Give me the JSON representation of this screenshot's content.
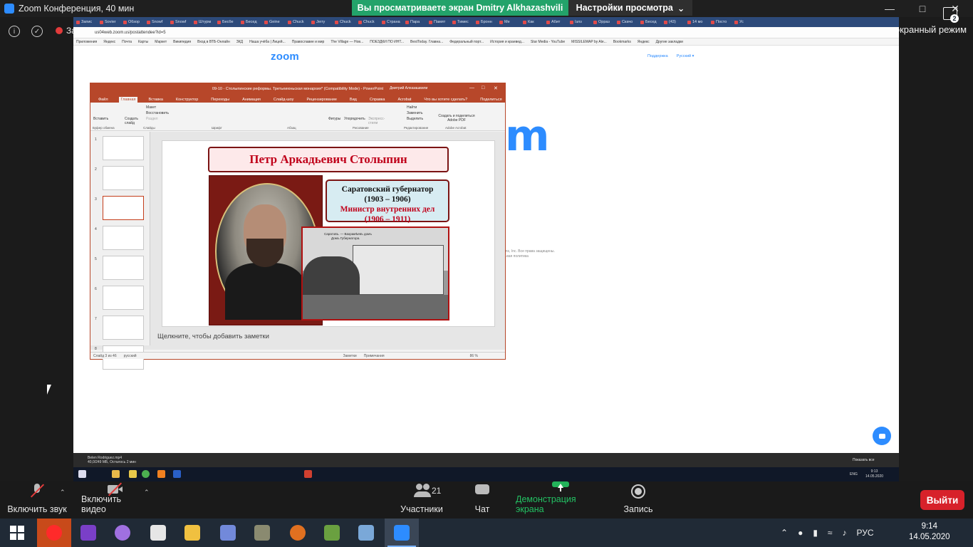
{
  "zoom": {
    "window_title": "Zoom Конференция, 40 мин",
    "share_banner": "Вы просматриваете экран Dmitry Alkhazashvili",
    "view_options": "Настройки просмотра",
    "recording_label": "Запись",
    "fullscreen_label": "Войти в полноэкранный режим"
  },
  "browser": {
    "tabs": [
      "Запис",
      "Sovier",
      "Обзор",
      "Snowf",
      "Snowf",
      "Штурм",
      "Бесбе",
      "Бесед",
      "Geine",
      "Chuck",
      "Jerry",
      "Chuck",
      "Chuck",
      "Страна",
      "Пара",
      "Памят",
      "Тимес",
      "Бронн",
      "Ме",
      "Как",
      "Абит",
      "Ізлз",
      "Орраз",
      "Скачо",
      "Бесед",
      "(43)",
      "14 мо",
      "Посто",
      "Ус"
    ],
    "url": "us04web.zoom.us/postattendee?id=5",
    "bookmarks": [
      "Приложения",
      "Яндекс",
      "Почта",
      "Карты",
      "Маркет",
      "Википедия",
      "Вход в ВТБ-Онлайн",
      "ЗКД",
      "Наша учёба | Лицей...",
      "Православие и мир",
      "The Village — Нов...",
      "ПОЕЗДКИ ПО ИНТ...",
      "BestToday. Главна...",
      "Федеральный порт...",
      "История и краевед...",
      "Star Media - YouTube",
      "MISSILEMAP by Ale...",
      "Bookmarks",
      "Яндекс",
      "Другие закладки"
    ]
  },
  "zoom_page": {
    "logo": "zoom",
    "links": [
      "Поддержка",
      "Русский ▾"
    ],
    "big_logo_fragment": "m",
    "copyright": "..ns, Inc. Все права защищены.",
    "privacy": "...вая политика"
  },
  "powerpoint": {
    "title": "09-10 - Столыпинские реформы. Третьеиюньская монархия* (Compatibility Mode) - PowerPoint",
    "user": "Дмитрий Алхазашвили",
    "tabs": [
      "Файл",
      "Главная",
      "Вставка",
      "Конструктор",
      "Переходы",
      "Анимация",
      "Слайд-шоу",
      "Рецензирование",
      "Вид",
      "Справка",
      "Acrobat",
      "Что вы хотите сделать?",
      "Поделиться"
    ],
    "active_tab": "Главная",
    "ribbon_groups": [
      "Буфер обмена",
      "Слайды",
      "Шрифт",
      "Абзац",
      "Рисование",
      "Редактирование",
      "Adobe Acrobat"
    ],
    "ribbon_buttons": {
      "paste": "Вставить",
      "new_slide": "Создать слайд",
      "layout": "Макет",
      "reset": "Восстановить",
      "section": "Раздел",
      "shapes": "Фигуры",
      "arrange": "Упорядочить",
      "quick_styles": "Экспресс-стили",
      "find": "Найти",
      "replace": "Заменить",
      "select": "Выделить",
      "create_pdf": "Создать и поделиться Adobe PDF"
    },
    "thumb_numbers": [
      "1",
      "2",
      "3",
      "4",
      "5",
      "6",
      "7",
      "8"
    ],
    "selected_thumb": 3,
    "slide": {
      "title": "Петр Аркадьевич Столыпин",
      "line1": "Саратовский губернатор",
      "line2": "(1903 – 1906)",
      "line3": "Министр внутренних дел",
      "line4": "(1906 – 1911)",
      "photo_caption": "Саратовъ. — Вахрамѣевъ домъ",
      "photo_caption2": "Домъ Губернатора."
    },
    "notes_placeholder": "Щелкните, чтобы добавить заметки",
    "status": {
      "slide_of": "Слайд 3 из 46",
      "language": "русский",
      "notes": "Заметки",
      "comments": "Примечания",
      "zoom": "86 %"
    }
  },
  "inner_screen": {
    "download_file": "Belen Rodriguez.mp4",
    "download_status": "40,0/249 МБ, Осталось 2 мин",
    "show_all": "Показать все",
    "lang": "ENG",
    "time": "9:13",
    "date": "14.05.2020"
  },
  "controls": {
    "unmute": "Включить звук",
    "start_video": "Включить видео",
    "participants": "Участники",
    "participants_count": "21",
    "chat": "Чат",
    "share_screen": "Демонстрация экрана",
    "record": "Запись",
    "leave": "Выйти"
  },
  "taskbar": {
    "lang": "РУС",
    "time": "9:14",
    "date": "14.05.2020",
    "notifications": "2",
    "apps": [
      "start-button",
      "opera",
      "visual-studio",
      "video-app",
      "unity",
      "file-explorer",
      "discord",
      "photo-app",
      "app-orange",
      "plot-app",
      "calculator",
      "zoom"
    ]
  },
  "colors": {
    "zoom_blue": "#2d8cff",
    "share_green": "#23a36a",
    "leave_red": "#d7212a",
    "ppt_red": "#b7472a",
    "slide_title_red": "#c0001a"
  }
}
